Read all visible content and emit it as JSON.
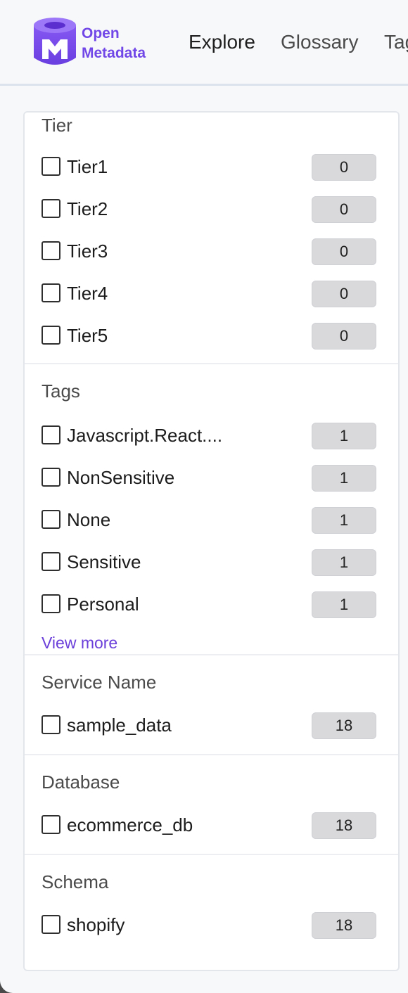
{
  "brand": {
    "line1": "Open",
    "line2": "Metadata",
    "accent": "#7147e8"
  },
  "nav": {
    "explore": "Explore",
    "glossary": "Glossary",
    "tags": "Tags"
  },
  "filters": {
    "tier": {
      "title": "Tier",
      "items": [
        {
          "label": "Tier1",
          "count": "0"
        },
        {
          "label": "Tier2",
          "count": "0"
        },
        {
          "label": "Tier3",
          "count": "0"
        },
        {
          "label": "Tier4",
          "count": "0"
        },
        {
          "label": "Tier5",
          "count": "0"
        }
      ]
    },
    "tags": {
      "title": "Tags",
      "items": [
        {
          "label": "Javascript.React....",
          "count": "1"
        },
        {
          "label": "NonSensitive",
          "count": "1"
        },
        {
          "label": "None",
          "count": "1"
        },
        {
          "label": "Sensitive",
          "count": "1"
        },
        {
          "label": "Personal",
          "count": "1"
        }
      ],
      "view_more": "View more"
    },
    "service": {
      "title": "Service Name",
      "items": [
        {
          "label": "sample_data",
          "count": "18"
        }
      ]
    },
    "database": {
      "title": "Database",
      "items": [
        {
          "label": "ecommerce_db",
          "count": "18"
        }
      ]
    },
    "schema": {
      "title": "Schema",
      "items": [
        {
          "label": "shopify",
          "count": "18"
        }
      ]
    }
  }
}
